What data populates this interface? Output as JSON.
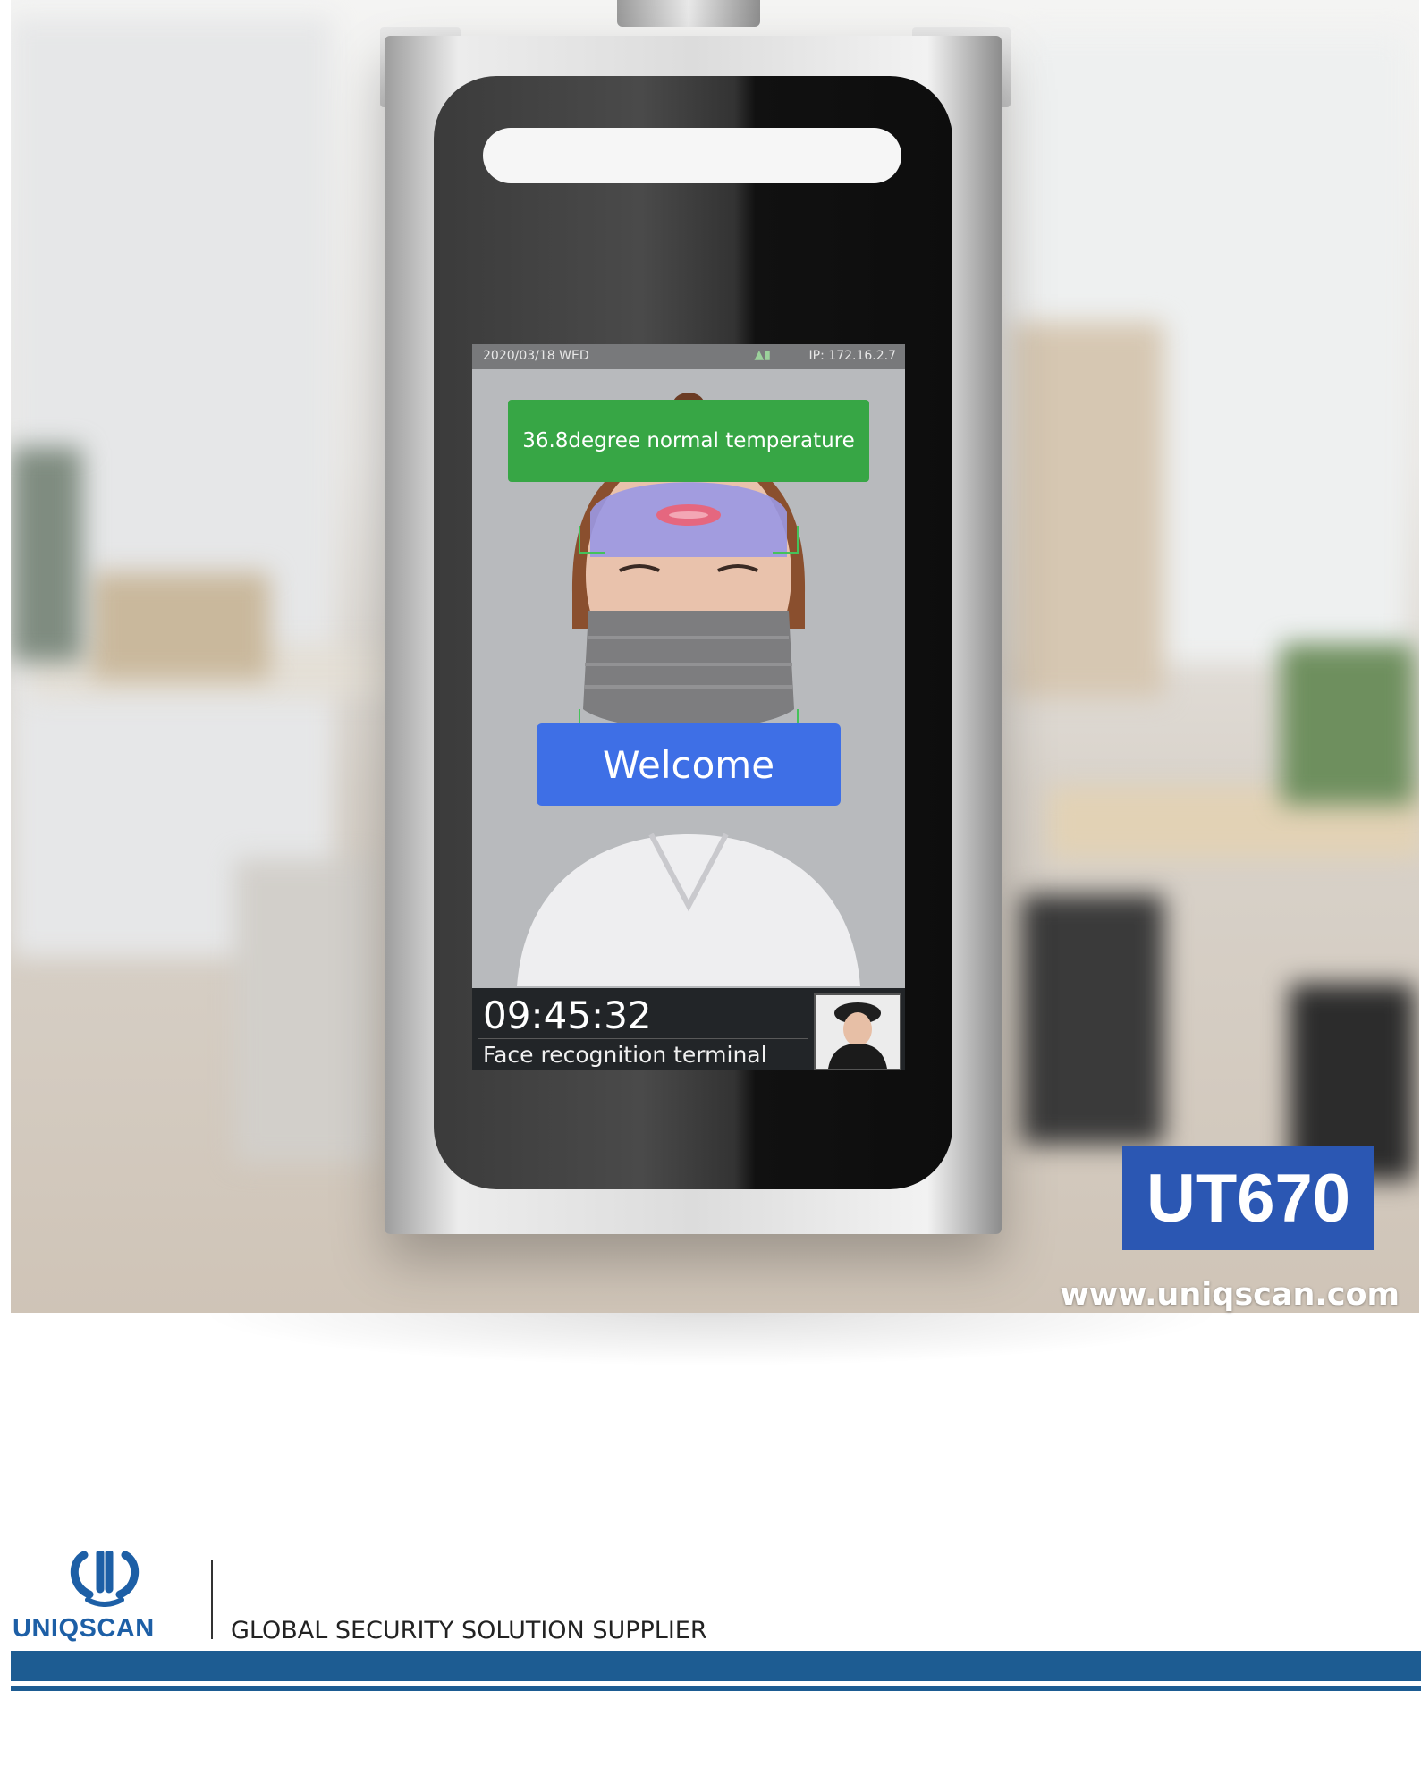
{
  "screen": {
    "date": "2020/03/18 WED",
    "ip": "IP: 172.16.2.7",
    "temperature_message": "36.8degree normal temperature",
    "welcome_message": "Welcome",
    "clock": "09:45:32",
    "terminal_label": "Face recognition terminal"
  },
  "product": {
    "model": "UT670",
    "website": "www.uniqscan.com"
  },
  "footer": {
    "brand": "UNIQSCAN",
    "tagline": "GLOBAL SECURITY SOLUTION SUPPLIER",
    "brand_color": "#1d5c92"
  },
  "icons": [
    "wifi-icon",
    "signal-icon",
    "logo-mark-icon"
  ],
  "colors": {
    "temperature_banner": "#37a645",
    "welcome_banner": "#3e6fe6",
    "model_badge": "#2b57b3"
  }
}
